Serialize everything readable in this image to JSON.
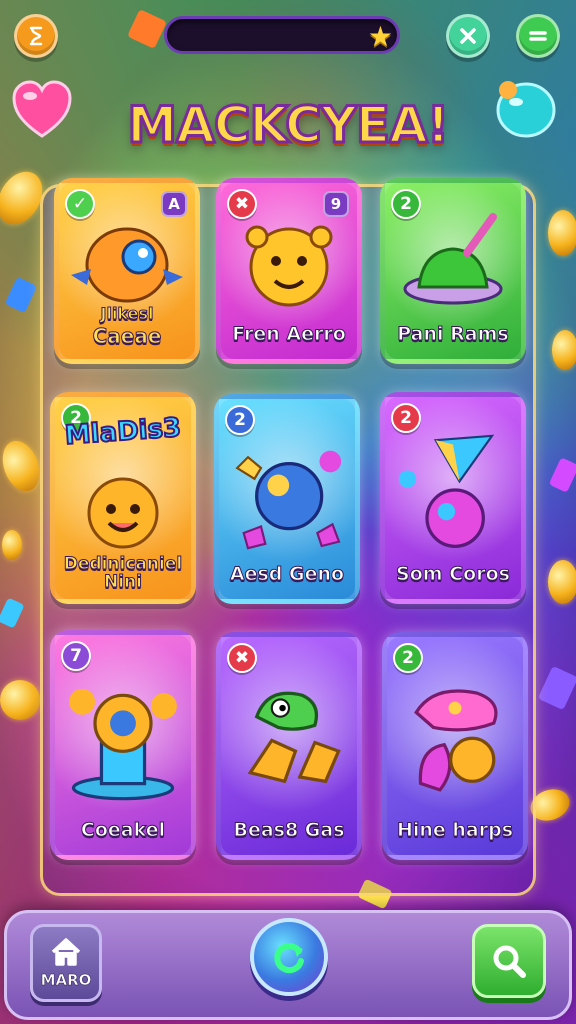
{
  "title": "MACKCYEA!",
  "top_bar": {
    "left_icon": "hourglass-icon",
    "progress_icon": "star-icon",
    "close_icon": "close-icon",
    "menu_icon": "menu-icon",
    "colors": {
      "left": "#f59a1c",
      "close": "#43d29a",
      "menu": "#3fcb52"
    }
  },
  "cards": [
    {
      "label": "Caeae",
      "top_text": "Jlikesl",
      "badge": "✓",
      "badge_type": "check",
      "corner": "A",
      "color": "#f7a51c"
    },
    {
      "label": "Fren Aerro",
      "badge": "✖",
      "badge_type": "cross",
      "corner": "9",
      "color": "#e43bd0"
    },
    {
      "label": "Pani Rams",
      "badge": "2",
      "badge_type": "num-green",
      "color": "#56d34a"
    },
    {
      "label": "Dedinicaniel",
      "label2": "Nini",
      "top_text": "MlaDis3",
      "badge": "2",
      "badge_type": "num-green",
      "color": "#f7a51c"
    },
    {
      "label": "Aesd Geno",
      "badge": "2",
      "badge_type": "num-blue",
      "color": "#38b7e8"
    },
    {
      "label": "Som Coros",
      "badge": "2",
      "badge_type": "num-red",
      "color": "#b43be0"
    },
    {
      "label": "Coeakel",
      "badge": "7",
      "badge_type": "num-purple",
      "color": "#c93be4"
    },
    {
      "label": "Beas8 Gas",
      "badge": "✖",
      "badge_type": "cross",
      "color": "#8a4be0"
    },
    {
      "label": "Hine harps",
      "badge": "2",
      "badge_type": "num-green",
      "color": "#7a5be0"
    }
  ],
  "bottom_bar": {
    "home_label": "MARO",
    "home_icon": "home-icon",
    "center_icon": "refresh-icon",
    "right_icon": "search-icon"
  }
}
